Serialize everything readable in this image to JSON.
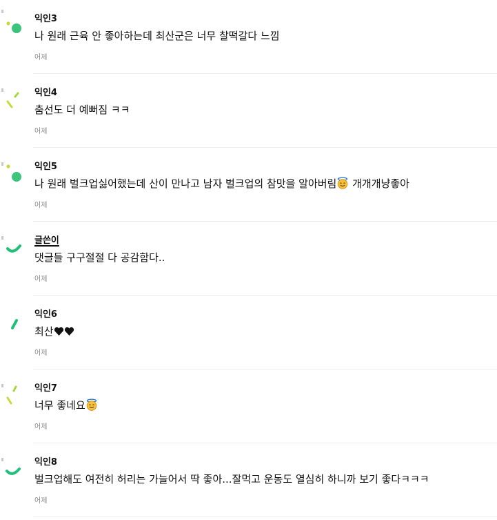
{
  "colors": {
    "avatar_green": "#3cc47c",
    "avatar_lime": "#a3d93a",
    "avatar_yellowgreen": "#c8d93a",
    "avatar_teal": "#1fbf77",
    "divider": "#ececec",
    "timestamp": "#8a8a8a"
  },
  "comments": [
    {
      "author": "익인3",
      "avatar_icon": "dots-avatar-icon",
      "text_before": "나 원래 근육 안 좋아하는데 최산군은 너무 찰떡갈다 느낌",
      "emoji": "",
      "text_after": "",
      "time": "어제"
    },
    {
      "author": "익인4",
      "avatar_icon": "dash-avatar-icon",
      "text_before": "춤선도 더 예뻐짐 ㅋㅋ",
      "emoji": "",
      "text_after": "",
      "time": "어제"
    },
    {
      "author": "익인5",
      "avatar_icon": "dots-avatar-icon",
      "text_before": "나 원래 벌크업싫어했는데 산이 만나고 남자 벌크업의 참맛을 알아버림",
      "emoji": "smiling-face-with-halo",
      "text_after": " 개개개냥좋아",
      "time": "어제"
    },
    {
      "author": "글쓴이",
      "avatar_icon": "arc-avatar-icon",
      "text_before": "댓글들 구구절절 다 공감함다..",
      "emoji": "",
      "text_after": "",
      "time": "어제"
    },
    {
      "author": "익인6",
      "avatar_icon": "bar-avatar-icon",
      "text_before": "최산",
      "emoji": "black-hearts",
      "text_after": "",
      "time": "어제"
    },
    {
      "author": "익인7",
      "avatar_icon": "dash-avatar-icon",
      "text_before": "너무 좋네요",
      "emoji": "smiling-face-with-halo",
      "text_after": "",
      "time": "어제"
    },
    {
      "author": "익인8",
      "avatar_icon": "arc-avatar-icon",
      "text_before": "벌크업해도 여전히 허리는 가늘어서 딱 좋아...잘먹고 운동도 열심히 하니까 보기 좋다ㅋㅋㅋ",
      "emoji": "",
      "text_after": "",
      "time": "어제"
    }
  ]
}
